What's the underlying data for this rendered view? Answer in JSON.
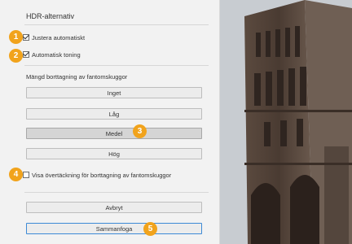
{
  "dialog": {
    "title": "HDR-alternativ",
    "checkbox1": {
      "label": "Justera automatiskt",
      "checked": true
    },
    "checkbox2": {
      "label": "Automatisk toning",
      "checked": true
    },
    "ghost_label": "Mängd borttagning av fantomskuggor",
    "ghost_buttons": [
      "Inget",
      "Låg",
      "Medel",
      "Hög"
    ],
    "selected_index": 2,
    "overlay_checkbox": {
      "label": "Visa övertäckning för borttagning av fantomskuggor",
      "checked": false
    },
    "cancel_label": "Avbryt",
    "merge_label": "Sammanfoga"
  },
  "annotations": [
    "1",
    "2",
    "3",
    "4",
    "5"
  ],
  "colors": {
    "badge": "#f1a31c",
    "primary_border": "#3d8ad6"
  }
}
